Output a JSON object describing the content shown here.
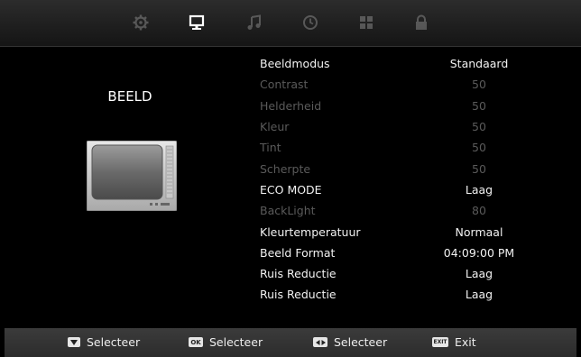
{
  "top_tabs": [
    {
      "icon": "gear-icon",
      "active": false
    },
    {
      "icon": "monitor-icon",
      "active": true
    },
    {
      "icon": "music-note-icon",
      "active": false
    },
    {
      "icon": "clock-icon",
      "active": false
    },
    {
      "icon": "grid-icon",
      "active": false
    },
    {
      "icon": "lock-icon",
      "active": false
    }
  ],
  "page_title": "BEELD",
  "settings": [
    {
      "label": "Beeldmodus",
      "value": "Standaard",
      "enabled": true
    },
    {
      "label": "Contrast",
      "value": "50",
      "enabled": false
    },
    {
      "label": "Helderheid",
      "value": "50",
      "enabled": false
    },
    {
      "label": "Kleur",
      "value": "50",
      "enabled": false
    },
    {
      "label": "Tint",
      "value": "50",
      "enabled": false
    },
    {
      "label": "Scherpte",
      "value": "50",
      "enabled": false
    },
    {
      "label": "ECO MODE",
      "value": "Laag",
      "enabled": true
    },
    {
      "label": "BackLight",
      "value": "80",
      "enabled": false
    },
    {
      "label": "Kleurtemperatuur",
      "value": "Normaal",
      "enabled": true
    },
    {
      "label": "Beeld Format",
      "value": "04:09:00 PM",
      "enabled": true
    },
    {
      "label": "Ruis Reductie",
      "value": "Laag",
      "enabled": true
    },
    {
      "label": "Ruis Reductie",
      "value": "Laag",
      "enabled": true
    }
  ],
  "hints": [
    {
      "key": "",
      "icon": "down-arrow-key-icon",
      "label": "Selecteer"
    },
    {
      "key": "OK",
      "icon": "ok-key-icon",
      "label": "Selecteer"
    },
    {
      "key": "",
      "icon": "left-right-key-icon",
      "label": "Selecteer"
    },
    {
      "key": "EXIT",
      "icon": "exit-key-icon",
      "label": "Exit"
    }
  ],
  "colors": {
    "text_active": "#f2f2f2",
    "text_disabled": "#5a5a5a",
    "bar": "#2c2c2c"
  }
}
